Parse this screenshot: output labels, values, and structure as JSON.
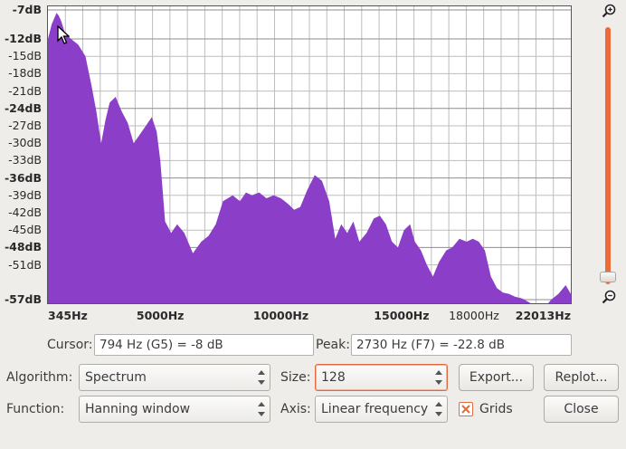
{
  "chart_data": {
    "type": "area",
    "title": "",
    "xlabel": "",
    "ylabel": "",
    "x_unit": "Hz",
    "y_unit": "dB",
    "xlim": [
      345,
      22013
    ],
    "ylim": [
      -57,
      -7
    ],
    "grid": true,
    "fill_color": "#8b3fc8",
    "y_tick_labels": [
      "-7dB",
      "-12dB",
      "-15dB",
      "-18dB",
      "-21dB",
      "-24dB",
      "-27dB",
      "-30dB",
      "-33dB",
      "-36dB",
      "-39dB",
      "-42dB",
      "-45dB",
      "-48dB",
      "-51dB",
      "-57dB"
    ],
    "y_major_ticks": [
      "-7dB",
      "-12dB",
      "-24dB",
      "-36dB",
      "-48dB",
      "-57dB"
    ],
    "y_tick_values": [
      -7,
      -12,
      -15,
      -18,
      -21,
      -24,
      -27,
      -30,
      -33,
      -36,
      -39,
      -42,
      -45,
      -48,
      -51,
      -57
    ],
    "x_tick_labels": [
      "345Hz",
      "5000Hz",
      "10000Hz",
      "15000Hz",
      "18000Hz",
      "22013Hz"
    ],
    "x_tick_values": [
      345,
      5000,
      10000,
      15000,
      18000,
      22013
    ],
    "x_major_ticks": [
      "345Hz",
      "5000Hz",
      "10000Hz",
      "15000Hz",
      "22013Hz"
    ],
    "series": [
      {
        "x": [
          345,
          500,
          700,
          794,
          900,
          1050,
          1300,
          1600,
          1900,
          2150,
          2350,
          2550,
          2730,
          2900,
          3150,
          3400,
          3650,
          3900,
          4150,
          4400,
          4650,
          4850,
          5000,
          5200,
          5450,
          5700,
          6000,
          6350,
          6700,
          7000,
          7300,
          7600,
          7800,
          8000,
          8300,
          8550,
          8800,
          9100,
          9400,
          9700,
          10000,
          10300,
          10550,
          10800,
          11100,
          11400,
          11700,
          12000,
          12250,
          12500,
          12750,
          13000,
          13250,
          13550,
          13850,
          14100,
          14350,
          14600,
          14850,
          15100,
          15350,
          15550,
          15800,
          16050,
          16300,
          16550,
          16850,
          17100,
          17400,
          17700,
          17950,
          18200,
          18450,
          18700,
          18950,
          19200,
          19450,
          19700,
          20000,
          20300,
          20600,
          20900,
          21200,
          21500,
          21800,
          22013
        ],
        "y": [
          -12,
          -9.5,
          -7.5,
          -8,
          -9,
          -11,
          -12,
          -13,
          -15,
          -20,
          -24.5,
          -30,
          -26,
          -23,
          -22,
          -24.5,
          -26.5,
          -30,
          -28.5,
          -27,
          -25.5,
          -28,
          -33,
          -43.5,
          -45.5,
          -44,
          -45.5,
          -49,
          -47,
          -46,
          -44,
          -40,
          -39.5,
          -39,
          -40,
          -38.5,
          -39,
          -38.5,
          -39.5,
          -39,
          -39.5,
          -40.5,
          -41.5,
          -41,
          -38,
          -35.5,
          -36.5,
          -40,
          -46.5,
          -44,
          -45.5,
          -43.5,
          -47,
          -45.5,
          -43,
          -42.5,
          -44,
          -47,
          -48,
          -45,
          -44,
          -47,
          -48.5,
          -51,
          -53,
          -50.5,
          -48.5,
          -48,
          -46.5,
          -47,
          -46.5,
          -47,
          -48.5,
          -53,
          -55,
          -55.8,
          -56,
          -56.5,
          -56.8,
          -57.5,
          -58.5,
          -58.5,
          -57,
          -56,
          -54.5,
          -56
        ]
      }
    ]
  },
  "readouts": {
    "cursor_label": "Cursor:",
    "cursor_value": "794 Hz (G5) = -8 dB",
    "peak_label": "Peak:",
    "peak_value": "2730 Hz (F7) = -22.8 dB"
  },
  "controls": {
    "algorithm_label": "Algorithm:",
    "algorithm_value": "Spectrum",
    "size_label": "Size:",
    "size_value": "128",
    "function_label": "Function:",
    "function_value": "Hanning window",
    "axis_label": "Axis:",
    "axis_value": "Linear frequency",
    "grids_label": "Grids",
    "grids_checked": true
  },
  "buttons": {
    "export": "Export...",
    "replot": "Replot...",
    "close": "Close"
  },
  "icons": {
    "zoom_in": "zoom-in-icon",
    "zoom_out": "zoom-out-icon",
    "mouse_cursor": "mouse-pointer-icon"
  },
  "colors": {
    "accent": "#e8693b",
    "plot_fill": "#8b3fc8",
    "grid": "#bdbdbd"
  }
}
